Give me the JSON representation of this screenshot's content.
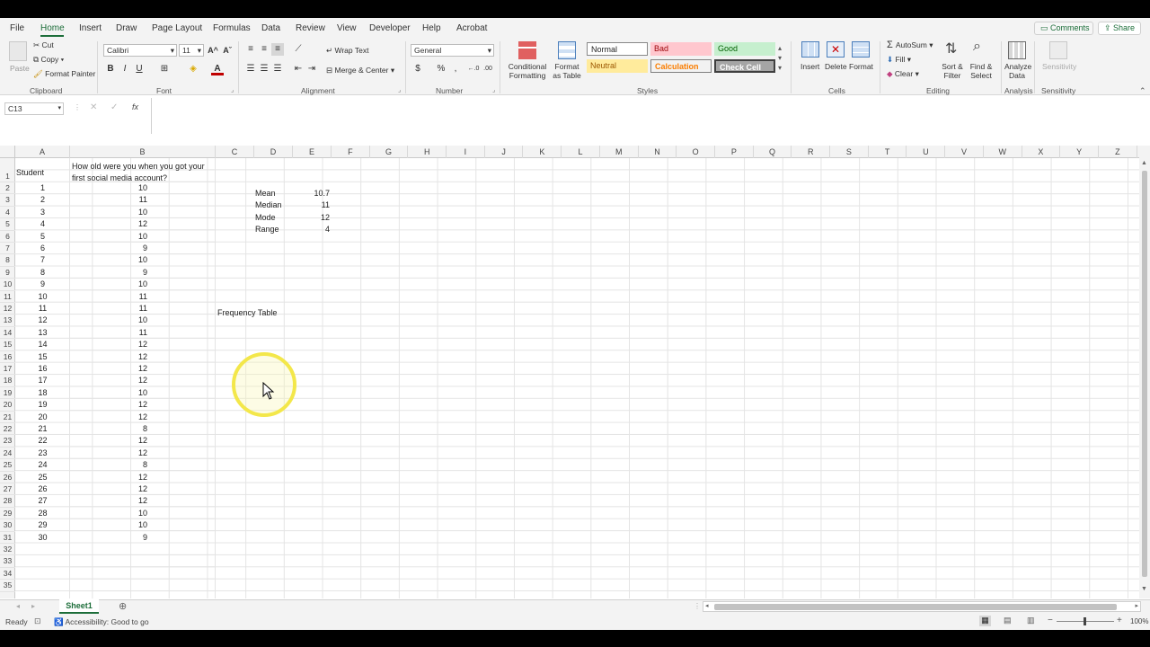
{
  "menu": {
    "tabs": [
      "File",
      "Home",
      "Insert",
      "Draw",
      "Page Layout",
      "Formulas",
      "Data",
      "Review",
      "View",
      "Developer",
      "Help",
      "Acrobat"
    ],
    "comments": "Comments",
    "share": "Share"
  },
  "ribbon": {
    "paste": "Paste",
    "cut": "Cut",
    "copy": "Copy",
    "format_painter": "Format Painter",
    "clipboard": "Clipboard",
    "font_name": "Calibri",
    "font_size": "11",
    "font": "Font",
    "wrap_text": "Wrap Text",
    "merge_center": "Merge & Center",
    "alignment": "Alignment",
    "number_format": "General",
    "number": "Number",
    "conditional_formatting": "Conditional Formatting",
    "format_as_table": "Format as Table",
    "style_normal": "Normal",
    "style_bad": "Bad",
    "style_good": "Good",
    "style_neutral": "Neutral",
    "style_calculation": "Calculation",
    "style_check": "Check Cell",
    "styles": "Styles",
    "insert": "Insert",
    "delete": "Delete",
    "format": "Format",
    "cells": "Cells",
    "autosum": "AutoSum",
    "fill": "Fill",
    "clear": "Clear",
    "sort_filter": "Sort & Filter",
    "find_select": "Find & Select",
    "editing": "Editing",
    "analyze_data": "Analyze Data",
    "analysis": "Analysis",
    "sensitivity": "Sensitivity",
    "sensitivity_group": "Sensitivity",
    "colors": {
      "bad_bg": "#ffc7ce",
      "bad_fg": "#9c0006",
      "good_bg": "#c6efce",
      "good_fg": "#006100",
      "neutral_bg": "#ffeb9c",
      "neutral_fg": "#9c5700",
      "calc_fg": "#fa7d00",
      "check_bg": "#a5a5a5",
      "accent": "#1d6e3a"
    }
  },
  "formula_bar": {
    "name_box": "C13",
    "fx": "fx",
    "value": ""
  },
  "columns": [
    "A",
    "B",
    "C",
    "D",
    "E",
    "F",
    "G",
    "H",
    "I",
    "J",
    "K",
    "L",
    "M",
    "N",
    "O",
    "P",
    "Q",
    "R",
    "S",
    "T",
    "U",
    "V",
    "W",
    "X",
    "Y",
    "Z"
  ],
  "rows": [
    "1",
    "2",
    "3",
    "4",
    "5",
    "6",
    "7",
    "8",
    "9",
    "10",
    "11",
    "12",
    "13",
    "14",
    "15",
    "16",
    "17",
    "18",
    "19",
    "20",
    "21",
    "22",
    "23",
    "24",
    "25",
    "26",
    "27",
    "28",
    "29",
    "30",
    "31",
    "32",
    "33",
    "34",
    "35"
  ],
  "sheet": {
    "a1": "Student",
    "b1_line1": "How old were you when you got your",
    "b1_line2": "first social media account?",
    "students": [
      "1",
      "2",
      "3",
      "4",
      "5",
      "6",
      "7",
      "8",
      "9",
      "10",
      "11",
      "12",
      "13",
      "14",
      "15",
      "16",
      "17",
      "18",
      "19",
      "20",
      "21",
      "22",
      "23",
      "24",
      "25",
      "26",
      "27",
      "28",
      "29",
      "30"
    ],
    "ages": [
      "10",
      "11",
      "10",
      "12",
      "10",
      "9",
      "10",
      "9",
      "10",
      "11",
      "11",
      "10",
      "11",
      "12",
      "12",
      "12",
      "12",
      "10",
      "12",
      "12",
      "8",
      "12",
      "12",
      "8",
      "12",
      "12",
      "12",
      "10",
      "10",
      "9"
    ],
    "stats": [
      {
        "label": "Mean",
        "value": "10.7"
      },
      {
        "label": "Median",
        "value": "11"
      },
      {
        "label": "Mode",
        "value": "12"
      },
      {
        "label": "Range",
        "value": "4"
      }
    ],
    "frequency_table": "Frequency Table"
  },
  "sheet_tab": "Sheet1",
  "status": {
    "ready": "Ready",
    "accessibility": "Accessibility: Good to go",
    "zoom": "100%"
  }
}
